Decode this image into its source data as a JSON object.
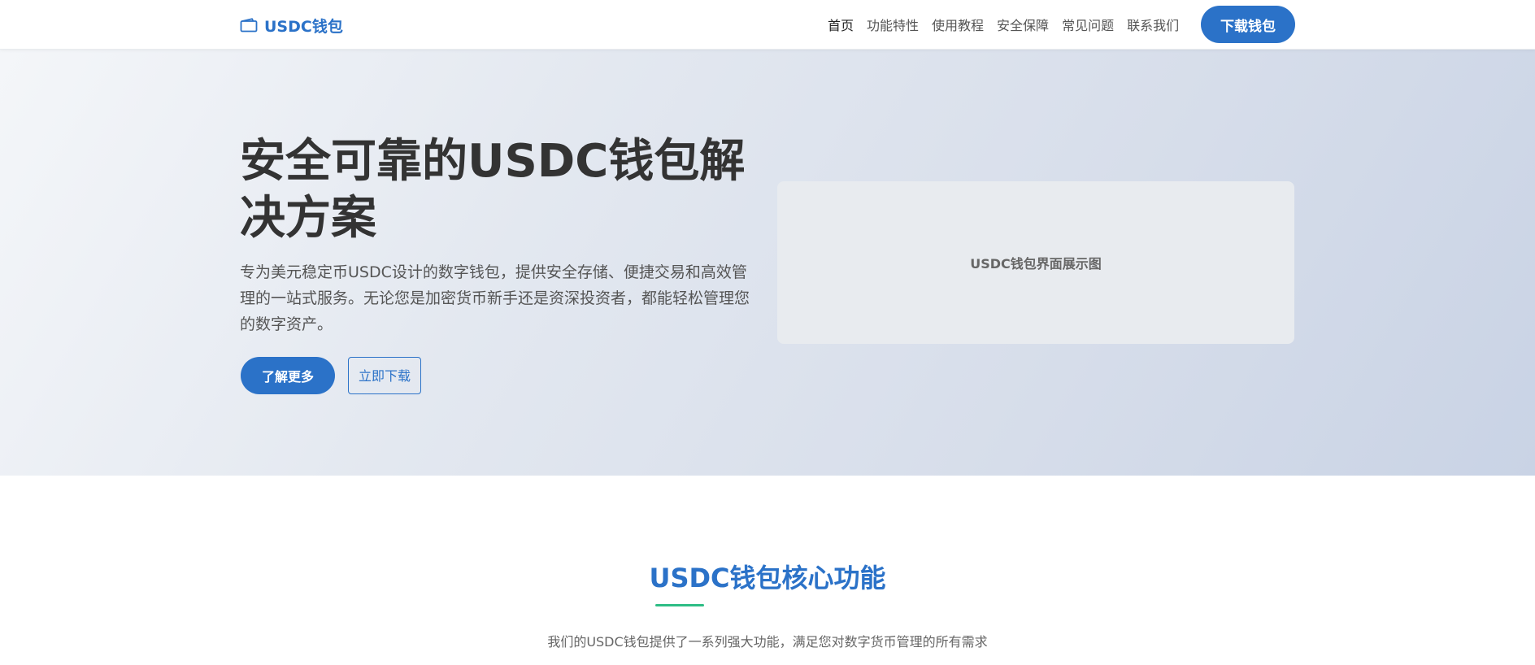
{
  "header": {
    "logo_text": "USDC钱包",
    "logo_icon": "wallet-icon",
    "nav": [
      {
        "label": "首页",
        "active": true
      },
      {
        "label": "功能特性",
        "active": false
      },
      {
        "label": "使用教程",
        "active": false
      },
      {
        "label": "安全保障",
        "active": false
      },
      {
        "label": "常见问题",
        "active": false
      },
      {
        "label": "联系我们",
        "active": false
      }
    ],
    "download_label": "下载钱包"
  },
  "hero": {
    "title": "安全可靠的USDC钱包解决方案",
    "description": "专为美元稳定币USDC设计的数字钱包，提供安全存储、便捷交易和高效管理的一站式服务。无论您是加密货币新手还是资深投资者，都能轻松管理您的数字资产。",
    "learn_more_label": "了解更多",
    "download_now_label": "立即下载",
    "mockup_label": "USDC钱包界面展示图"
  },
  "features": {
    "title": "USDC钱包核心功能",
    "subtitle": "我们的USDC钱包提供了一系列强大功能，满足您对数字货币管理的所有需求"
  },
  "colors": {
    "primary": "#2b72c8",
    "accent": "#2ebd85",
    "text_dark": "#333333",
    "text_muted": "#555555"
  }
}
